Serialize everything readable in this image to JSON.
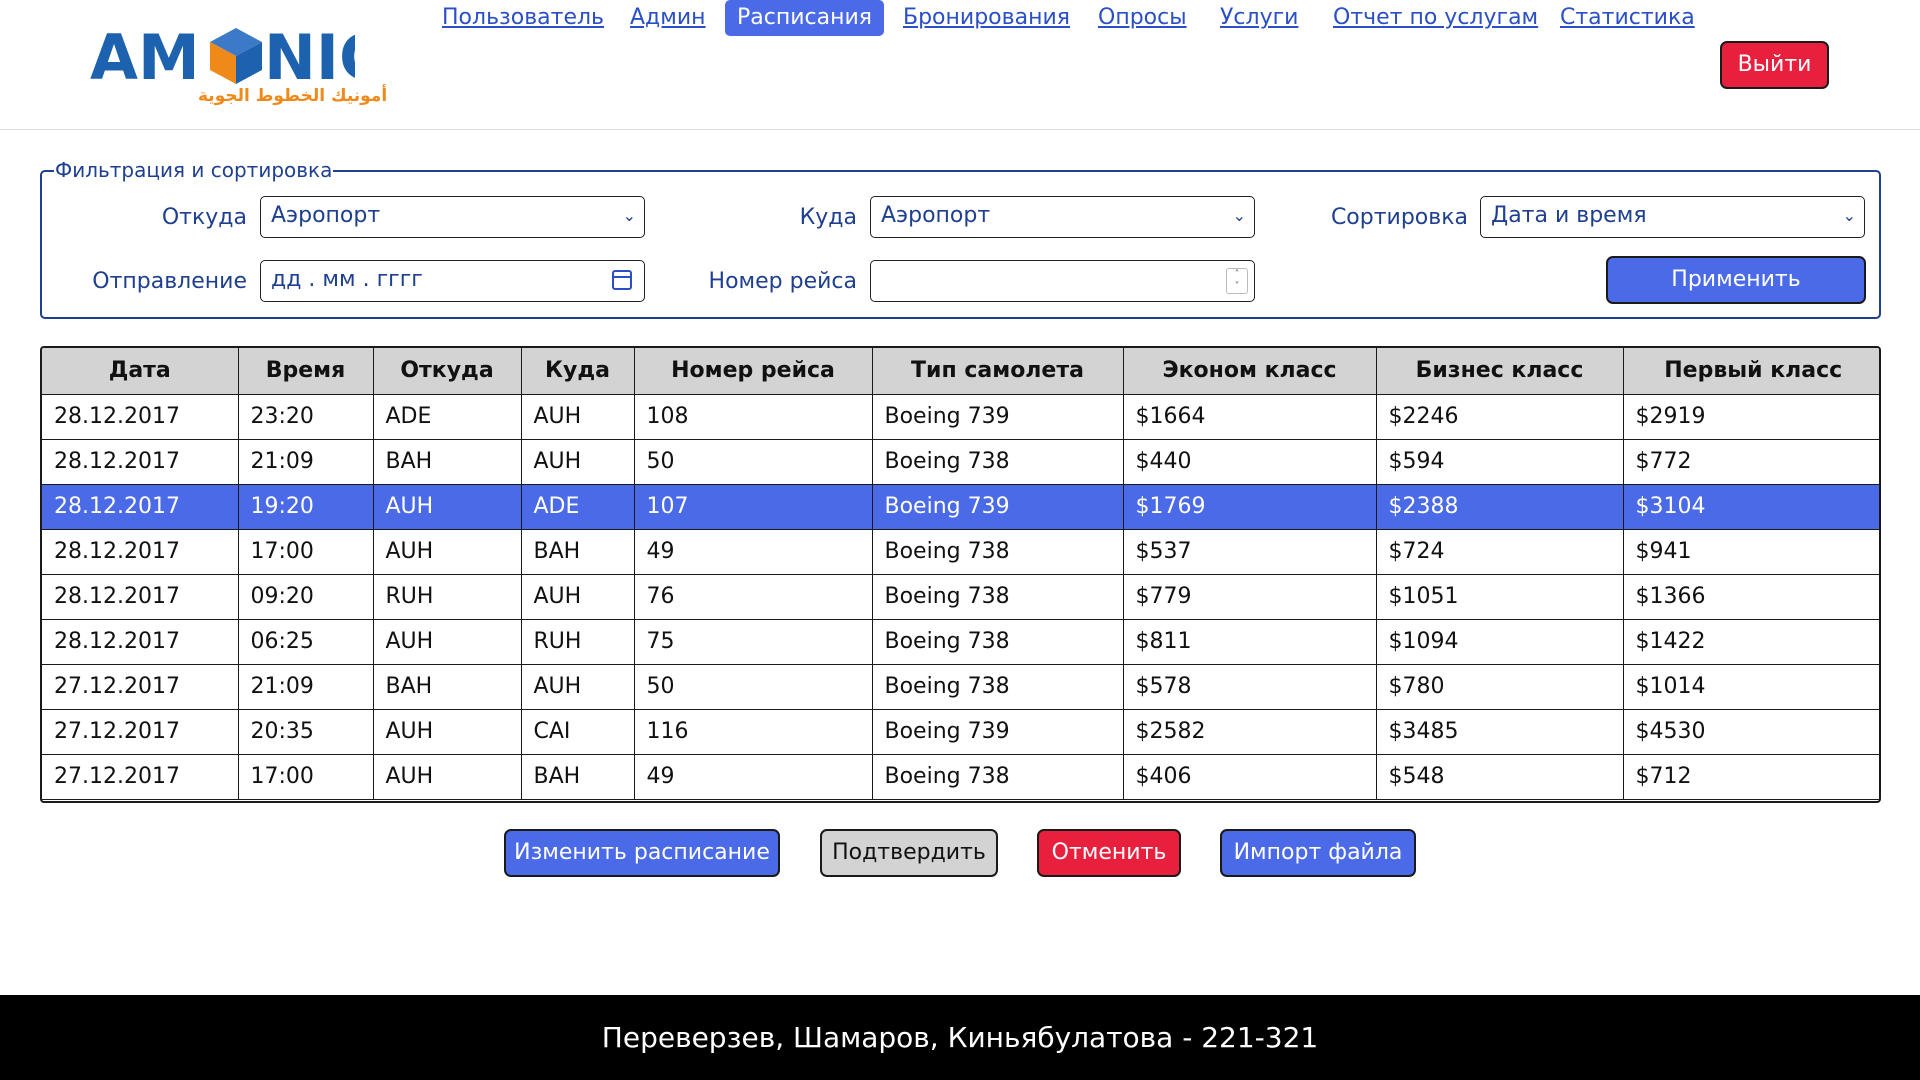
{
  "logo": {
    "word": "AMONIC",
    "subtitle": "أمونيك الخطوط الجوية"
  },
  "nav": {
    "items": [
      {
        "label": "Пользователь"
      },
      {
        "label": "Админ"
      },
      {
        "label": "Расписания",
        "active": true
      },
      {
        "label": "Бронирования"
      },
      {
        "label": "Опросы"
      },
      {
        "label": "Услуги"
      },
      {
        "label": "Отчет по услугам"
      },
      {
        "label": "Статистика"
      }
    ],
    "logout_label": "Выйти"
  },
  "filter": {
    "legend": "Фильтрация и сортировка",
    "from_label": "Откуда",
    "from_value": "Аэропорт",
    "to_label": "Куда",
    "to_value": "Аэропорт",
    "sort_label": "Сортировка",
    "sort_value": "Дата и время",
    "departure_label": "Отправление",
    "departure_placeholder": "дд . мм . гггг",
    "flight_label": "Номер рейса",
    "flight_value": "",
    "apply_label": "Применить"
  },
  "table": {
    "columns": [
      "Дата",
      "Время",
      "Откуда",
      "Куда",
      "Номер рейса",
      "Тип самолета",
      "Эконом класс",
      "Бизнес класс",
      "Первый класс"
    ],
    "selected_row": 2,
    "rows": [
      [
        "28.12.2017",
        "23:20",
        "ADE",
        "AUH",
        "108",
        "Boeing 739",
        "$1664",
        "$2246",
        "$2919"
      ],
      [
        "28.12.2017",
        "21:09",
        "BAH",
        "AUH",
        "50",
        "Boeing 738",
        "$440",
        "$594",
        "$772"
      ],
      [
        "28.12.2017",
        "19:20",
        "AUH",
        "ADE",
        "107",
        "Boeing 739",
        "$1769",
        "$2388",
        "$3104"
      ],
      [
        "28.12.2017",
        "17:00",
        "AUH",
        "BAH",
        "49",
        "Boeing 738",
        "$537",
        "$724",
        "$941"
      ],
      [
        "28.12.2017",
        "09:20",
        "RUH",
        "AUH",
        "76",
        "Boeing 738",
        "$779",
        "$1051",
        "$1366"
      ],
      [
        "28.12.2017",
        "06:25",
        "AUH",
        "RUH",
        "75",
        "Boeing 738",
        "$811",
        "$1094",
        "$1422"
      ],
      [
        "27.12.2017",
        "21:09",
        "BAH",
        "AUH",
        "50",
        "Boeing 738",
        "$578",
        "$780",
        "$1014"
      ],
      [
        "27.12.2017",
        "20:35",
        "AUH",
        "CAI",
        "116",
        "Boeing 739",
        "$2582",
        "$3485",
        "$4530"
      ],
      [
        "27.12.2017",
        "17:00",
        "AUH",
        "BAH",
        "49",
        "Boeing 738",
        "$406",
        "$548",
        "$712"
      ]
    ]
  },
  "actions": {
    "edit_label": "Изменить расписание",
    "confirm_label": "Подтвердить",
    "cancel_label": "Отменить",
    "import_label": "Импорт файла"
  },
  "footer": {
    "text": "Переверзев, Шамаров, Киньябулатова - 221-321"
  },
  "colors": {
    "accent": "#4a6ae8",
    "danger": "#e8203e",
    "brand_blue": "#1c62ae",
    "brand_orange": "#ef8a1a"
  }
}
